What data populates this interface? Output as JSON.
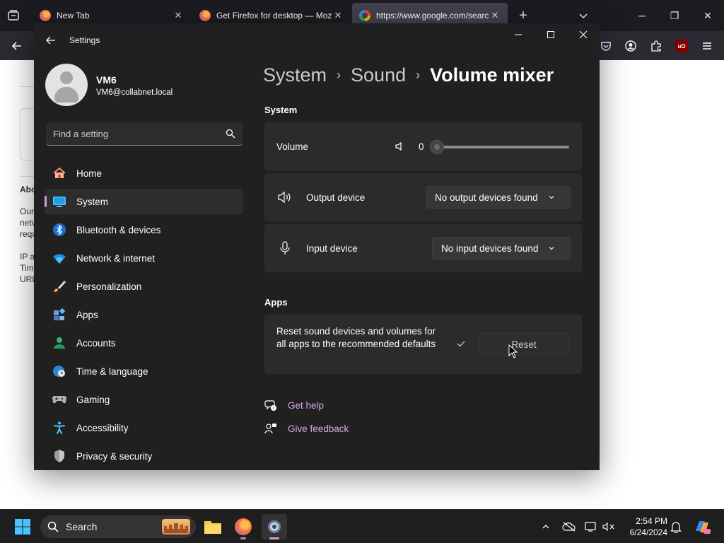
{
  "browser": {
    "tabs": [
      {
        "title": "New Tab",
        "active": false
      },
      {
        "title": "Get Firefox for desktop — Mozi",
        "active": false
      },
      {
        "title": "https://www.google.com/searc",
        "active": true
      }
    ],
    "extension_badge": "uO"
  },
  "page_fragments": [
    "Abo",
    "Our",
    "netv",
    "requ",
    "IP a",
    "Tim",
    "URL"
  ],
  "settings": {
    "window_title": "Settings",
    "user": {
      "name": "VM6",
      "email": "VM6@collabnet.local"
    },
    "search_placeholder": "Find a setting",
    "nav": [
      {
        "label": "Home",
        "icon": "home-icon"
      },
      {
        "label": "System",
        "icon": "system-icon",
        "active": true
      },
      {
        "label": "Bluetooth & devices",
        "icon": "bluetooth-icon"
      },
      {
        "label": "Network & internet",
        "icon": "wifi-icon"
      },
      {
        "label": "Personalization",
        "icon": "brush-icon"
      },
      {
        "label": "Apps",
        "icon": "apps-icon"
      },
      {
        "label": "Accounts",
        "icon": "accounts-icon"
      },
      {
        "label": "Time & language",
        "icon": "globe-clock-icon"
      },
      {
        "label": "Gaming",
        "icon": "gamepad-icon"
      },
      {
        "label": "Accessibility",
        "icon": "accessibility-icon"
      },
      {
        "label": "Privacy & security",
        "icon": "shield-icon"
      }
    ],
    "breadcrumb": [
      "System",
      "Sound",
      "Volume mixer"
    ],
    "system_section": "System",
    "volume": {
      "label": "Volume",
      "value": "0",
      "level": 0
    },
    "output": {
      "label": "Output device",
      "selected": "No output devices found"
    },
    "input": {
      "label": "Input device",
      "selected": "No input devices found"
    },
    "apps_section": "Apps",
    "reset": {
      "text": "Reset sound devices and volumes for all apps to the recommended defaults",
      "button": "Reset"
    },
    "links": {
      "help": "Get help",
      "feedback": "Give feedback"
    }
  },
  "taskbar": {
    "search": "Search",
    "time": "2:54 PM",
    "date": "6/24/2024"
  },
  "colors": {
    "accent": "#d79ad6",
    "link": "#d6a7e9",
    "window_bg": "#202020",
    "card_bg": "#2b2b2b"
  }
}
